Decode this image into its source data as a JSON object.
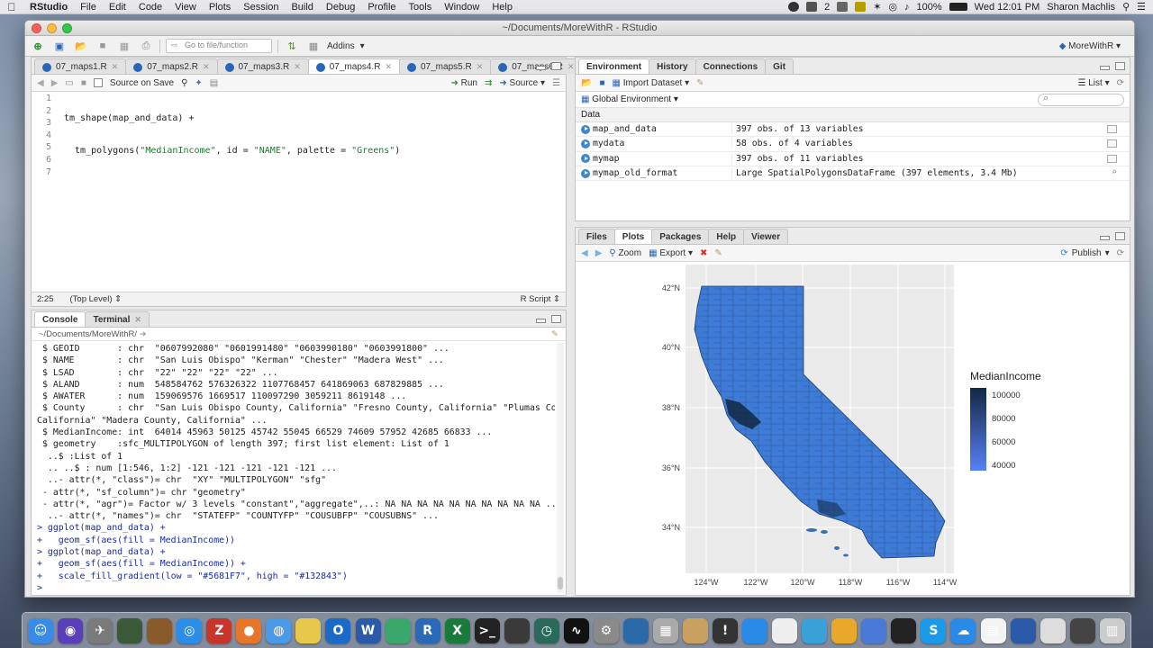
{
  "menubar": {
    "apple": "",
    "app": "RStudio",
    "items": [
      "File",
      "Edit",
      "Code",
      "View",
      "Plots",
      "Session",
      "Build",
      "Debug",
      "Profile",
      "Tools",
      "Window",
      "Help"
    ],
    "status_icons": [
      "evernote-icon",
      "dropbox-icon",
      "drive-icon",
      "shield-icon",
      "bluetooth-icon",
      "wifi-icon",
      "volume-icon"
    ],
    "badge": "2",
    "battery": "100%",
    "clock": "Wed 12:01 PM",
    "user": "Sharon Machlis"
  },
  "window": {
    "title": "~/Documents/MoreWithR - RStudio",
    "go_to_file_placeholder": "Go to file/function",
    "addins": "Addins",
    "project": "MoreWithR"
  },
  "editor": {
    "tabs": [
      "07_maps1.R",
      "07_maps2.R",
      "07_maps3.R",
      "07_maps4.R",
      "07_maps5.R",
      "07_maps6.R"
    ],
    "active_tab": 3,
    "source_on_save": "Source on Save",
    "run": "Run",
    "source": "Source",
    "line_numbers": [
      "1",
      "2",
      "3",
      "4",
      "5",
      "6",
      "7"
    ],
    "line1": "tm_shape(map_and_data) +",
    "line2_a": "  tm_polygons(",
    "line2_s1": "\"MedianIncome\"",
    "line2_b": ", id = ",
    "line2_s2": "\"NAME\"",
    "line2_c": ", palette = ",
    "line2_s3": "\"Greens\"",
    "line2_d": ")",
    "cursor": "2:25",
    "scope": "(Top Level)",
    "filetype": "R Script"
  },
  "console": {
    "tabs": [
      "Console",
      "Terminal"
    ],
    "path": "~/Documents/MoreWithR/",
    "lines": [
      {
        "t": " $ GEOID       : chr  \"0607992080\" \"0601991480\" \"0603990180\" \"0603991800\" ...",
        "c": false
      },
      {
        "t": " $ NAME        : chr  \"San Luis Obispo\" \"Kerman\" \"Chester\" \"Madera West\" ...",
        "c": false
      },
      {
        "t": " $ LSAD        : chr  \"22\" \"22\" \"22\" \"22\" ...",
        "c": false
      },
      {
        "t": " $ ALAND       : num  548584762 576326322 1107768457 641869063 687829885 ...",
        "c": false
      },
      {
        "t": " $ AWATER      : num  159069576 1669517 110097290 3059211 8619148 ...",
        "c": false
      },
      {
        "t": " $ County      : chr  \"San Luis Obispo County, California\" \"Fresno County, California\" \"Plumas County,",
        "c": false
      },
      {
        "t": "California\" \"Madera County, California\" ...",
        "c": false
      },
      {
        "t": " $ MedianIncome: int  64014 45963 50125 45742 55045 66529 74609 57952 42685 66833 ...",
        "c": false
      },
      {
        "t": " $ geometry    :sfc_MULTIPOLYGON of length 397; first list element: List of 1",
        "c": false
      },
      {
        "t": "  ..$ :List of 1",
        "c": false
      },
      {
        "t": "  .. ..$ : num [1:546, 1:2] -121 -121 -121 -121 -121 ...",
        "c": false
      },
      {
        "t": "  ..- attr(*, \"class\")= chr  \"XY\" \"MULTIPOLYGON\" \"sfg\"",
        "c": false
      },
      {
        "t": " - attr(*, \"sf_column\")= chr \"geometry\"",
        "c": false
      },
      {
        "t": " - attr(*, \"agr\")= Factor w/ 3 levels \"constant\",\"aggregate\",..: NA NA NA NA NA NA NA NA NA NA ...",
        "c": false
      },
      {
        "t": "  ..- attr(*, \"names\")= chr  \"STATEFP\" \"COUNTYFP\" \"COUSUBFP\" \"COUSUBNS\" ...",
        "c": false
      },
      {
        "t": "> ggplot(map_and_data) +",
        "c": true
      },
      {
        "t": "+   geom_sf(aes(fill = MedianIncome))",
        "c": true
      },
      {
        "t": "> ggplot(map_and_data) +",
        "c": true
      },
      {
        "t": "+   geom_sf(aes(fill = MedianIncome)) +",
        "c": true
      },
      {
        "t": "+   scale_fill_gradient(low = \"#5681F7\", high = \"#132843\")",
        "c": true
      },
      {
        "t": "> ",
        "c": true
      }
    ]
  },
  "environment": {
    "tabs": [
      "Environment",
      "History",
      "Connections",
      "Git"
    ],
    "import_dataset": "Import Dataset",
    "list_mode": "List",
    "scope": "Global Environment",
    "section": "Data",
    "rows": [
      {
        "name": "map_and_data",
        "value": "397 obs. of 13 variables",
        "icon": "grid-icon"
      },
      {
        "name": "mydata",
        "value": "58 obs. of 4 variables",
        "icon": "grid-icon"
      },
      {
        "name": "mymap",
        "value": "397 obs. of 11 variables",
        "icon": "grid-icon"
      },
      {
        "name": "mymap_old_format",
        "value": "Large SpatialPolygonsDataFrame (397 elements, 3.4 Mb)",
        "icon": "magnify-icon"
      }
    ]
  },
  "plots": {
    "tabs": [
      "Files",
      "Plots",
      "Packages",
      "Help",
      "Viewer"
    ],
    "active_tab": 1,
    "zoom": "Zoom",
    "export": "Export",
    "publish": "Publish",
    "map": {
      "y_ticks": [
        "42°N",
        "40°N",
        "38°N",
        "36°N",
        "34°N"
      ],
      "x_ticks": [
        "124°W",
        "122°W",
        "120°W",
        "118°W",
        "116°W",
        "114°W"
      ],
      "legend_title": "MedianIncome",
      "legend_values": [
        "100000",
        "80000",
        "60000",
        "40000"
      ],
      "color_low": "#5681F7",
      "color_high": "#132843",
      "fill_main": "#3d7bd6",
      "panel_bg": "#ebebeb"
    }
  },
  "dock": {
    "icons": [
      "finder-icon",
      "siri-icon",
      "launchpad-icon",
      "app-icon",
      "app-icon",
      "safari-icon",
      "filezilla-icon",
      "firefox-icon",
      "chrome-icon",
      "app-icon",
      "outlook-icon",
      "word-icon",
      "app-icon",
      "rstudio-icon",
      "excel-icon",
      "terminal-icon",
      "app-icon",
      "time-machine-icon",
      "activity-icon",
      "system-preferences-icon",
      "app-icon",
      "calculator-icon",
      "app-icon",
      "console-icon",
      "app-icon",
      "app-icon",
      "app-icon",
      "app-icon",
      "app-icon",
      "app-icon",
      "skype-icon",
      "onedrive-icon",
      "document-icon",
      "app-icon",
      "app-icon",
      "app-icon",
      "trash-icon"
    ],
    "outlook_badge": "164",
    "console_badge": "WARNI\nLY 7:36"
  }
}
